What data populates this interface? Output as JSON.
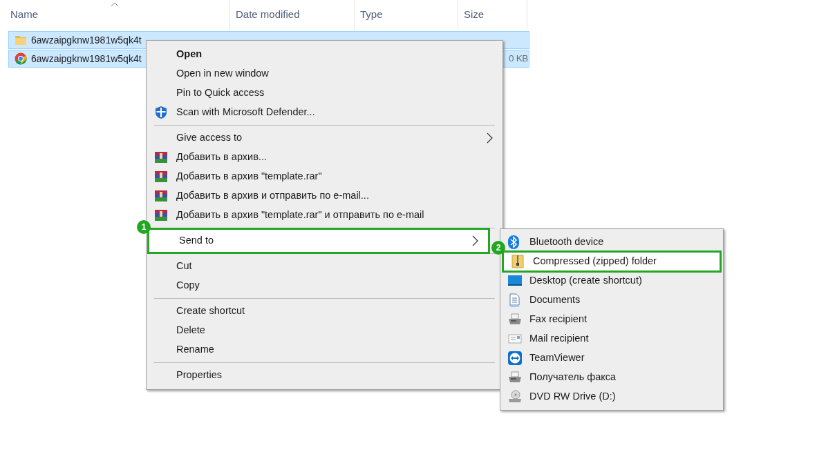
{
  "columns": [
    {
      "label": "Name",
      "sorted": true
    },
    {
      "label": "Date modified",
      "sorted": false
    },
    {
      "label": "Type",
      "sorted": false
    },
    {
      "label": "Size",
      "sorted": false
    }
  ],
  "files": [
    {
      "kind": "folder",
      "name": "6awzaipgknw1981w5qk4t",
      "selected": true
    },
    {
      "kind": "chrome",
      "name": "6awzaipgknw1981w5qk4t",
      "size": "0 KB",
      "selected": true
    }
  ],
  "context_menu": {
    "items": [
      {
        "kind": "item",
        "label": "Open",
        "bold": true
      },
      {
        "kind": "item",
        "label": "Open in new window"
      },
      {
        "kind": "item",
        "label": "Pin to Quick access"
      },
      {
        "kind": "item",
        "label": "Scan with Microsoft Defender..."
      },
      {
        "kind": "separator"
      },
      {
        "kind": "item",
        "label": "Give access to",
        "submenu": true
      },
      {
        "kind": "item",
        "label": "Добавить в архив..."
      },
      {
        "kind": "item",
        "label": "Добавить в архив \"template.rar\""
      },
      {
        "kind": "item",
        "label": "Добавить в архив и отправить по e-mail..."
      },
      {
        "kind": "item",
        "label": "Добавить в архив \"template.rar\" и отправить по e-mail"
      },
      {
        "kind": "separator"
      },
      {
        "kind": "item",
        "label": "Send to",
        "submenu": true,
        "selected": true,
        "callout": "1"
      },
      {
        "kind": "separator"
      },
      {
        "kind": "item",
        "label": "Cut"
      },
      {
        "kind": "item",
        "label": "Copy"
      },
      {
        "kind": "separator"
      },
      {
        "kind": "item",
        "label": "Create shortcut"
      },
      {
        "kind": "item",
        "label": "Delete"
      },
      {
        "kind": "item",
        "label": "Rename"
      },
      {
        "kind": "separator"
      },
      {
        "kind": "item",
        "label": "Properties"
      }
    ]
  },
  "send_to_menu": {
    "items": [
      {
        "label": "Bluetooth device",
        "selected": false
      },
      {
        "label": "Compressed (zipped) folder",
        "selected": true,
        "callout": "2"
      },
      {
        "label": "Desktop (create shortcut)",
        "selected": false
      },
      {
        "label": "Documents",
        "selected": false
      },
      {
        "label": "Fax recipient",
        "selected": false
      },
      {
        "label": "Mail recipient",
        "selected": false
      },
      {
        "label": "TeamViewer",
        "selected": false
      },
      {
        "label": "Получатель факса",
        "selected": false
      },
      {
        "label": "DVD RW Drive (D:)",
        "selected": false
      }
    ]
  }
}
